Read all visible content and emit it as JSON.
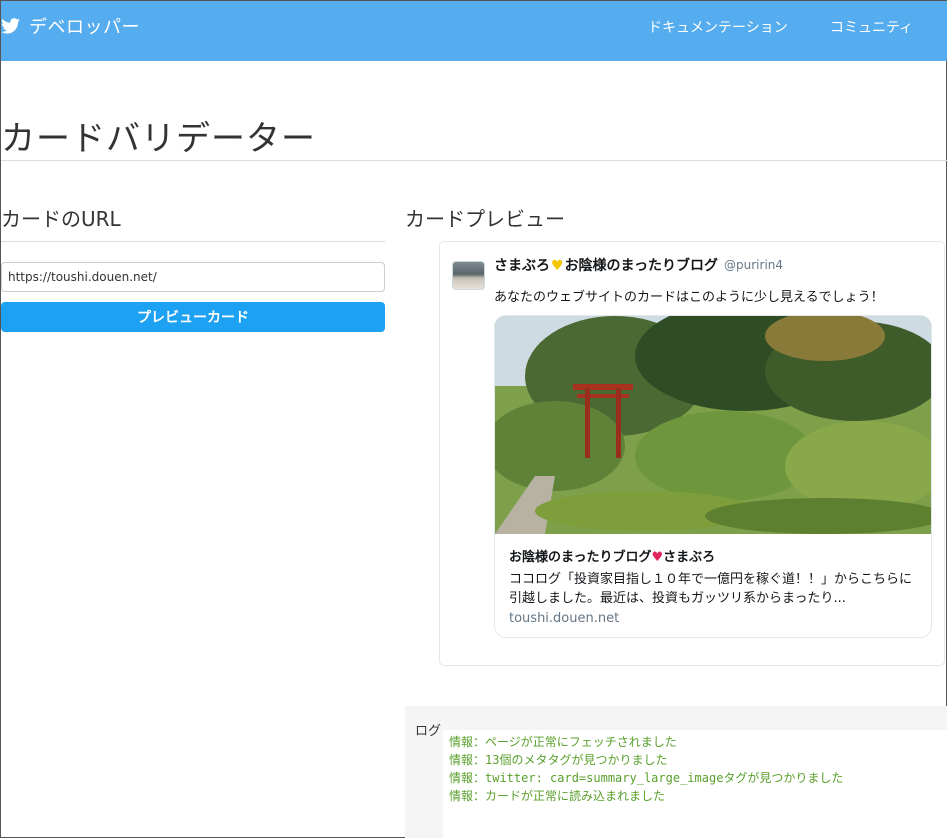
{
  "header": {
    "brand": "デベロッパー",
    "nav": [
      {
        "label": "ドキュメンテーション"
      },
      {
        "label": "コミュニティ"
      }
    ]
  },
  "page": {
    "title": "カードバリデーター"
  },
  "form": {
    "heading": "カードのURL",
    "url_value": "https://toushi.douen.net/",
    "button_label": "プレビューカード"
  },
  "preview": {
    "heading": "カードプレビュー",
    "tweet": {
      "display_name_prefix": "さまぶろ",
      "display_name_suffix": "お陰様のまったりブログ",
      "screen_name": "@puririn4",
      "text": "あなたのウェブサイトのカードはこのように少し見えるでしょう！"
    },
    "card": {
      "title_prefix": "お陰様のまったりブログ",
      "title_suffix": "さまぶろ",
      "description": "ココログ「投資家目指し１０年で一億円を稼ぐ道！！」からこちらに引越しました。最近は、投資もガッツリ系からまったり...",
      "domain": "toushi.douen.net"
    }
  },
  "log": {
    "label": "ログ",
    "lines": [
      "情報：ページが正常にフェッチされました",
      "情報：13個のメタタグが見つかりました",
      "情報：twitter: card=summary_large_imageタグが見つかりました",
      "情報：カードが正常に読み込まれました"
    ]
  },
  "colors": {
    "header_bg": "#55acee",
    "button_bg": "#1da1f2",
    "log_text": "#5aa02c"
  },
  "icons": {
    "brand": "twitter-bird-icon",
    "name_emoji": "yellow-heart-icon",
    "title_emoji": "red-heart-icon"
  }
}
